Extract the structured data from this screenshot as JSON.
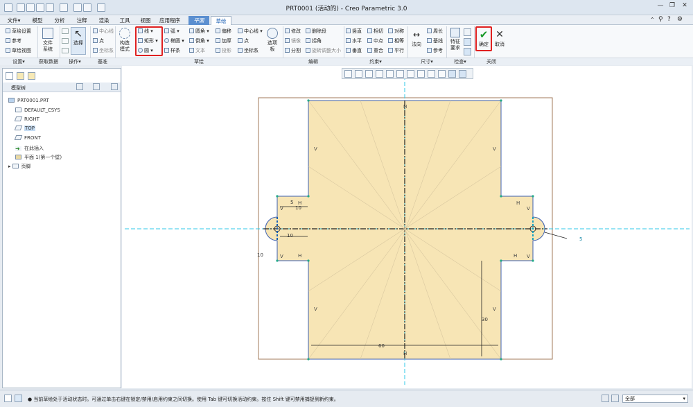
{
  "window": {
    "title": "PRT0001 (活动的) - Creo Parametric 3.0",
    "controls": [
      "—",
      "❐",
      "✕"
    ]
  },
  "tabs": [
    {
      "label": "文件▾"
    },
    {
      "label": "模型"
    },
    {
      "label": "分析"
    },
    {
      "label": "注释"
    },
    {
      "label": "渲染"
    },
    {
      "label": "工具"
    },
    {
      "label": "视图"
    },
    {
      "label": "应用程序"
    },
    {
      "label": "平面"
    },
    {
      "label": "草绘"
    }
  ],
  "ribbon": {
    "setup": {
      "items": [
        "草绘设置",
        "参考",
        "草绘视图"
      ],
      "group": "设置▾"
    },
    "getdata": {
      "file_system": "文件系统",
      "group": "获取数据"
    },
    "ops": {
      "select": "选择",
      "group": "操作▾"
    },
    "datum": {
      "items": [
        "中心线",
        "点",
        "坐标系"
      ],
      "group": "基准"
    },
    "sketch": {
      "construction": "构造模式",
      "line": "线 ▾",
      "rect": "矩形 ▾",
      "circle": "圆 ▾",
      "arc": "弧 ▾",
      "ellipse": "椭圆 ▾",
      "spline": "样条",
      "fillet": "圆角 ▾",
      "chamfer": "倒角 ▾",
      "text": "文本",
      "offset": "偏移",
      "thicken": "加厚",
      "project": "投影",
      "centerline": "中心线 ▾",
      "point": "点",
      "csys": "坐标系",
      "palette": "选项板",
      "group": "草绘"
    },
    "edit": {
      "items": [
        "修改",
        "删除段",
        "镜像",
        "拐角",
        "分割",
        "旋转调整大小"
      ],
      "group": "编辑"
    },
    "constraint": {
      "items": [
        "竖直",
        "相切",
        "对称",
        "水平",
        "中点",
        "相等",
        "垂直",
        "重合",
        "平行"
      ],
      "group": "约束▾"
    },
    "dimension": {
      "normal": "法向",
      "items": [
        "周长",
        "基线",
        "参考"
      ],
      "group": "尺寸▾"
    },
    "inspect": {
      "feature_req": "特征要求",
      "group": "检查▾"
    },
    "close": {
      "ok": "确定",
      "cancel": "取消",
      "group": "关闭"
    }
  },
  "tree": {
    "header": "模型树",
    "items": [
      "PRT0001.PRT",
      "DEFAULT_CSYS",
      "RIGHT",
      "TOP",
      "FRONT",
      "在此插入",
      "平面 1(第一个壁)",
      "页脚"
    ]
  },
  "sketch_dims": {
    "top_w": "10",
    "top_v": "5",
    "mid": "10",
    "left": "10",
    "bottom_w": "60",
    "right_h": "30",
    "leader": "5"
  },
  "status": {
    "message": "● 当前草绘处于活动状态时。可通过单击右键在锁定/禁用/启用约束之间切换。使用 Tab 键可切换活动约束。按住 Shift 键可禁用捕捉到新约束。",
    "filter": "全部"
  }
}
